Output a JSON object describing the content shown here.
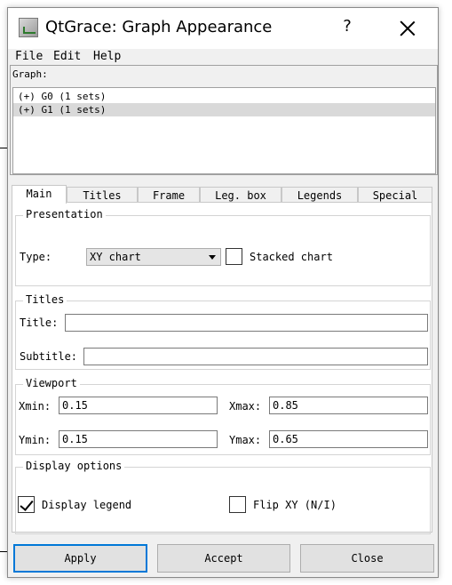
{
  "window": {
    "title": "QtGrace: Graph Appearance",
    "help_label": "?"
  },
  "menu": {
    "file": "File",
    "edit": "Edit",
    "help": "Help"
  },
  "graph_panel": {
    "label": "Graph:",
    "graphs": [
      "(+) G0 (1 sets)",
      "(+) G1 (1 sets)"
    ],
    "selected_index": 1
  },
  "tabs": [
    "Main",
    "Titles",
    "Frame",
    "Leg. box",
    "Legends",
    "Special"
  ],
  "active_tab": "Main",
  "presentation": {
    "group_title": "Presentation",
    "type_label": "Type:",
    "type_value": "XY chart",
    "stacked_label": "Stacked chart",
    "stacked_checked": false
  },
  "titles": {
    "group_title": "Titles",
    "title_label": "Title:",
    "title_value": "",
    "subtitle_label": "Subtitle:",
    "subtitle_value": ""
  },
  "viewport": {
    "group_title": "Viewport",
    "xmin_label": "Xmin:",
    "xmin_value": "0.15",
    "xmax_label": "Xmax:",
    "xmax_value": "0.85",
    "ymin_label": "Ymin:",
    "ymin_value": "0.15",
    "ymax_label": "Ymax:",
    "ymax_value": "0.65"
  },
  "display_options": {
    "group_title": "Display options",
    "display_legend_label": "Display legend",
    "display_legend_checked": true,
    "flip_xy_label": "Flip XY (N/I)",
    "flip_xy_checked": false
  },
  "buttons": {
    "apply": "Apply",
    "accept": "Accept",
    "close": "Close"
  },
  "colors": {
    "focus_accent": "#0078d7",
    "window_bg": "#f0f0f0",
    "selected_row": "#d9d9d9"
  }
}
